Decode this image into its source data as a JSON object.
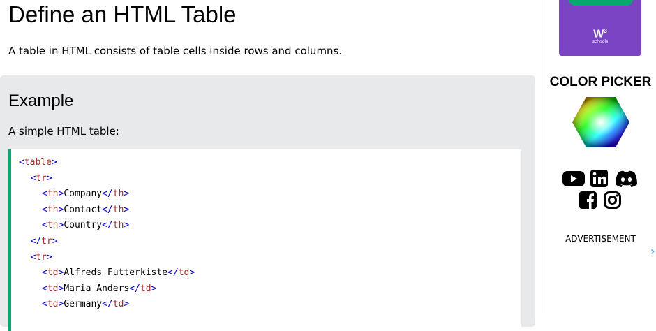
{
  "main": {
    "title": "Define an HTML Table",
    "intro": "A table in HTML consists of table cells inside rows and columns.",
    "example": {
      "heading": "Example",
      "description": "A simple HTML table:",
      "code_lines": [
        {
          "indent": 0,
          "tag": "table",
          "text": "",
          "close": false,
          "inline_close": false
        },
        {
          "indent": 1,
          "tag": "tr",
          "text": "",
          "close": false,
          "inline_close": false
        },
        {
          "indent": 2,
          "tag": "th",
          "text": "Company",
          "close": false,
          "inline_close": true
        },
        {
          "indent": 2,
          "tag": "th",
          "text": "Contact",
          "close": false,
          "inline_close": true
        },
        {
          "indent": 2,
          "tag": "th",
          "text": "Country",
          "close": false,
          "inline_close": true
        },
        {
          "indent": 1,
          "tag": "tr",
          "text": "",
          "close": true,
          "inline_close": false
        },
        {
          "indent": 1,
          "tag": "tr",
          "text": "",
          "close": false,
          "inline_close": false
        },
        {
          "indent": 2,
          "tag": "td",
          "text": "Alfreds Futterkiste",
          "close": false,
          "inline_close": true
        },
        {
          "indent": 2,
          "tag": "td",
          "text": "Maria Anders",
          "close": false,
          "inline_close": true
        },
        {
          "indent": 2,
          "tag": "td",
          "text": "Germany",
          "close": false,
          "inline_close": true
        }
      ]
    }
  },
  "sidebar": {
    "promo_logo": "W",
    "promo_logo_sup": "3",
    "promo_sub": "schools",
    "color_picker_title": "COLOR PICKER",
    "social_icons": [
      "youtube-icon",
      "linkedin-icon",
      "discord-icon",
      "facebook-icon",
      "instagram-icon"
    ],
    "advertisement": "ADVERTISEMENT",
    "scroll_arrow": "›"
  },
  "colors": {
    "accent_green": "#04aa6d",
    "example_bg": "#e7e9eb",
    "tag_color": "#a52a2a",
    "bracket_color": "#0000cd",
    "promo_purple": "#7a44c4"
  }
}
